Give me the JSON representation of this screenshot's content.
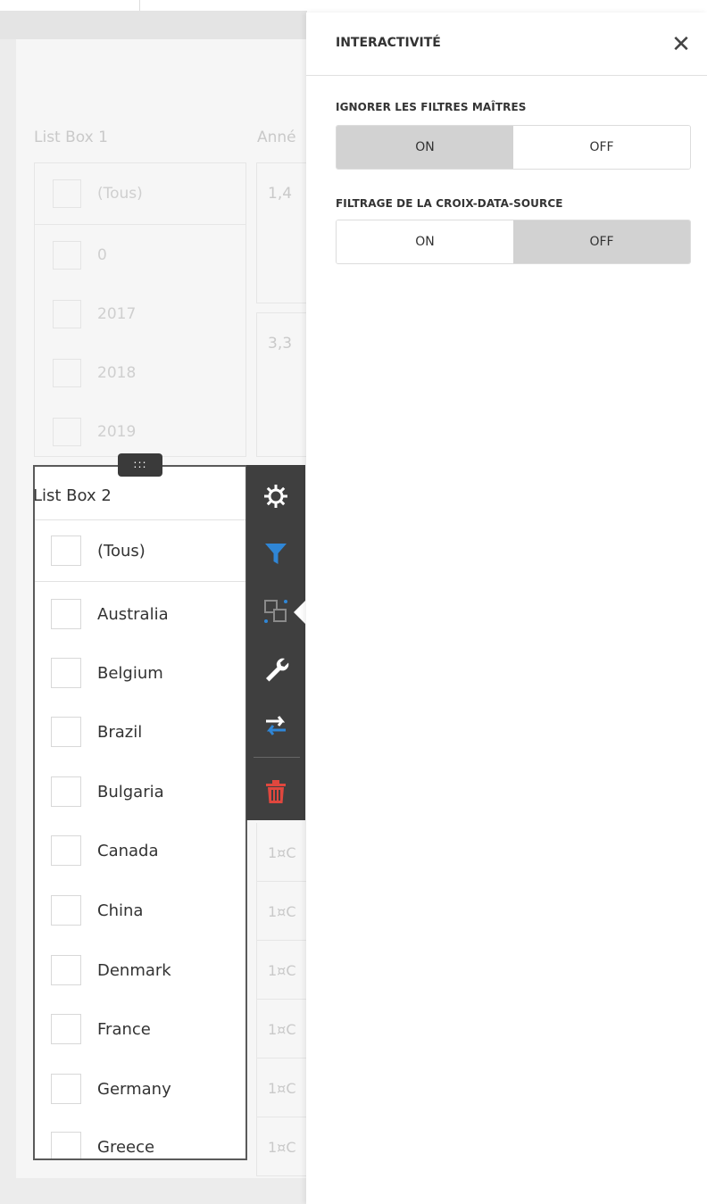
{
  "background": {
    "listbox1": {
      "title": "List Box 1",
      "items": [
        "(Tous)",
        "0",
        "2017",
        "2018",
        "2019"
      ]
    },
    "year_column": {
      "header": "Anné",
      "values": [
        "1,4",
        "3,3"
      ],
      "row_values": [
        "1¤C",
        "1¤C",
        "1¤C",
        "1¤C",
        "1¤C",
        "1¤C"
      ]
    }
  },
  "listbox2": {
    "title": "List Box 2",
    "header_item": "(Tous)",
    "items": [
      "Australia",
      "Belgium",
      "Brazil",
      "Bulgaria",
      "Canada",
      "China",
      "Denmark",
      "France",
      "Germany",
      "Greece"
    ]
  },
  "drag_handle": {
    "glyph": ":::"
  },
  "toolbar": {
    "icons": [
      "gear-icon",
      "filter-icon",
      "interactivity-icon",
      "wrench-icon",
      "swap-icon",
      "trash-icon"
    ],
    "colors": {
      "bg": "#3f3f3f",
      "filter": "#2f86d6",
      "swap": "#2f86d6",
      "trash": "#e0473e"
    }
  },
  "panel": {
    "title": "INTERACTIVITÉ",
    "close_glyph": "✕",
    "ignore_master": {
      "label": "IGNORER LES FILTRES MAÎTRES",
      "on": "ON",
      "off": "OFF",
      "selected": "ON"
    },
    "cross_datasource": {
      "label": "FILTRAGE DE LA CROIX-DATA-SOURCE",
      "on": "ON",
      "off": "OFF",
      "selected": "OFF"
    }
  }
}
